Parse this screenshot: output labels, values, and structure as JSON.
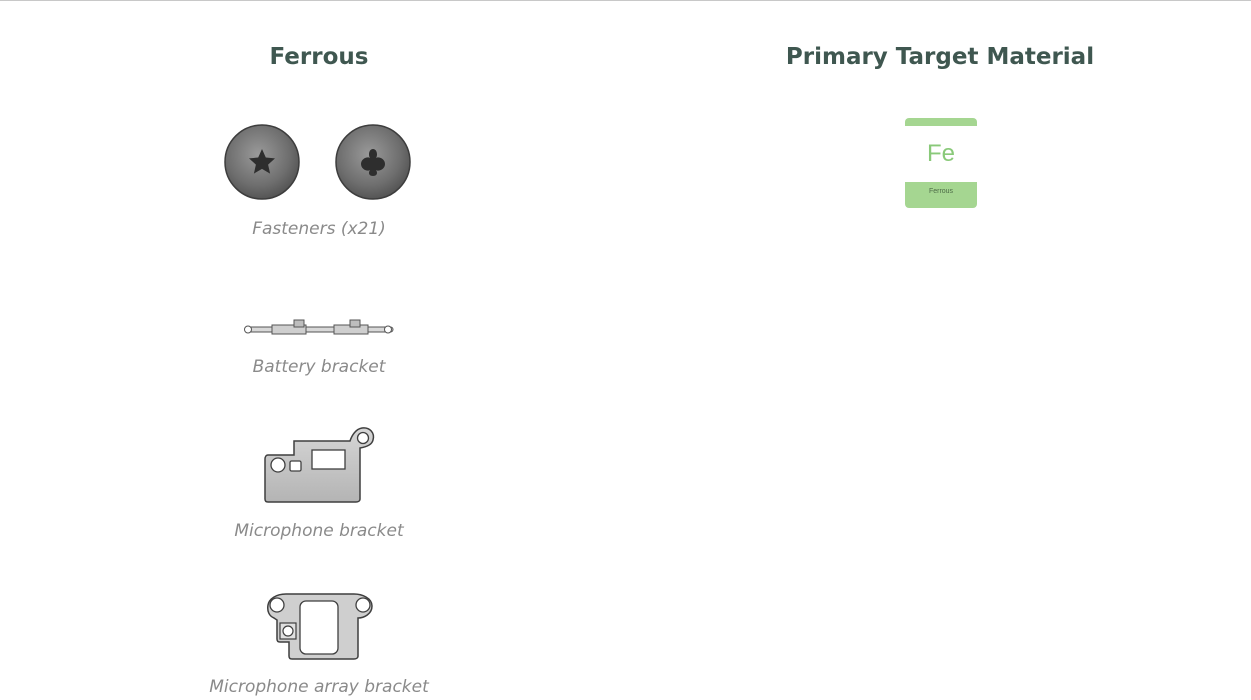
{
  "left_column": {
    "heading": "Ferrous",
    "parts": [
      {
        "caption": "Fasteners (x21)",
        "icon": "screw-heads-icon"
      },
      {
        "caption": "Battery bracket",
        "icon": "battery-bracket-icon"
      },
      {
        "caption": "Microphone bracket",
        "icon": "microphone-bracket-icon"
      },
      {
        "caption": "Microphone array bracket",
        "icon": "microphone-array-bracket-icon"
      }
    ]
  },
  "right_column": {
    "heading": "Primary Target Material",
    "element": {
      "symbol": "Fe",
      "name": "Ferrous",
      "color": "#a5d691"
    }
  },
  "colors": {
    "heading": "#3f5750",
    "caption": "#8a8a8a",
    "part_stroke": "#555555",
    "part_fill": "#c4c4c4"
  }
}
